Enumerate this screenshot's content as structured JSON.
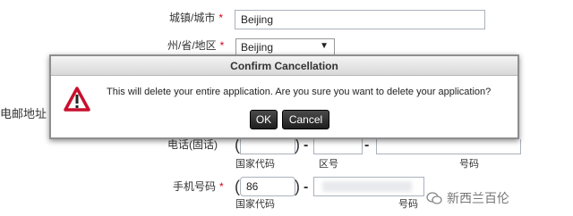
{
  "form": {
    "city_label": "城镇/城市",
    "city_value": "Beijing",
    "state_label": "州/省/地区",
    "state_value": "Beijing",
    "required_mark": "*",
    "address_partial_label": "电邮地址",
    "phone_partial_label": "电话(固话)",
    "country_code_label": "国家代码",
    "area_code_label": "区号",
    "number_label": "号码",
    "mobile_label": "手机号码",
    "mobile_country_code_value": "86",
    "mobile_country_code_label": "国家代码",
    "mobile_number_label": "号码",
    "open_paren": "(",
    "close_paren": ")",
    "dash": "-"
  },
  "dialog": {
    "title": "Confirm Cancellation",
    "message": "This will delete your entire application. Are you sure you want to delete your application?",
    "ok_label": "OK",
    "cancel_label": "Cancel"
  },
  "watermark": {
    "text": "新西兰百伦"
  },
  "colors": {
    "required": "#d0021b",
    "button_bg": "#2b2b2b",
    "warning_red": "#c8102e"
  }
}
